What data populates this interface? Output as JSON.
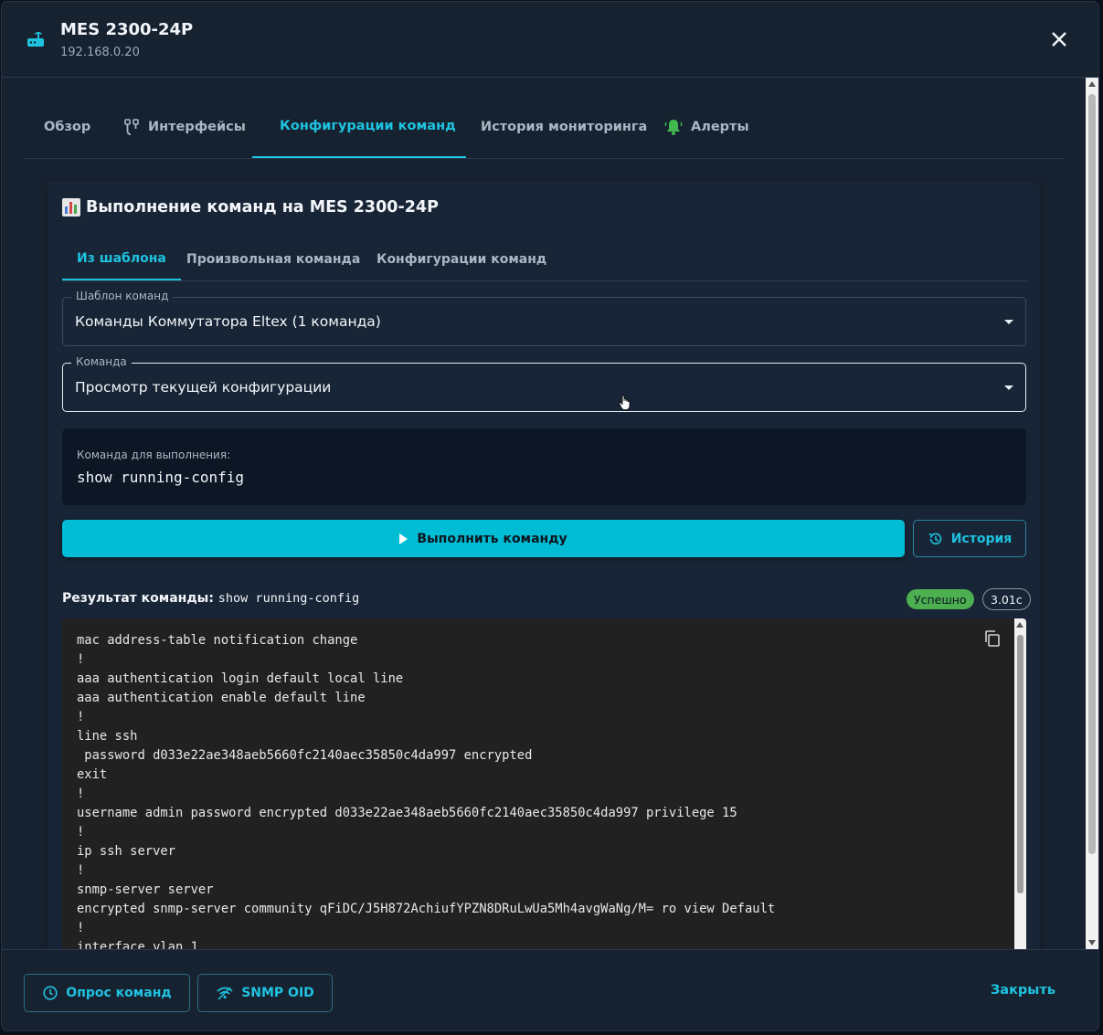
{
  "header": {
    "title": "MES 2300-24P",
    "subtitle": "192.168.0.20"
  },
  "tabs": [
    {
      "label": "Обзор",
      "icon": "none",
      "active": false
    },
    {
      "label": "Интерфейсы",
      "icon": "cable-icon",
      "active": false
    },
    {
      "label": "Конфигурации команд",
      "icon": "speedometer-icon",
      "active": true
    },
    {
      "label": "История мониторинга",
      "icon": "none",
      "active": false
    },
    {
      "label": "Алерты",
      "icon": "bell-icon",
      "active": false
    }
  ],
  "card": {
    "title": "Выполнение команд на MES 2300-24P",
    "title_icon": "bar-chart-emoji",
    "subtabs": [
      {
        "label": "Из шаблона",
        "active": true
      },
      {
        "label": "Произвольная команда",
        "active": false
      },
      {
        "label": "Конфигурации команд",
        "active": false
      }
    ],
    "template_field": {
      "label": "Шаблон команд",
      "value": "Команды Коммутатора Eltex (1 команда)"
    },
    "command_field": {
      "label": "Команда",
      "value": "Просмотр текущей конфигурации"
    },
    "command_box": {
      "label": "Команда для выполнения:",
      "command": "show running-config"
    },
    "run_button": "Выполнить команду",
    "history_button": "История",
    "result": {
      "label": "Результат команды:",
      "command": "show running-config",
      "status": "Успешно",
      "duration": "3.01с",
      "output_lines": [
        "mac address-table notification change",
        "!",
        "aaa authentication login default local line",
        "aaa authentication enable default line",
        "!",
        "line ssh",
        " password d033e22ae348aeb5660fc2140aec35850c4da997 encrypted",
        "exit",
        "!",
        "username admin password encrypted d033e22ae348aeb5660fc2140aec35850c4da997 privilege 15",
        "!",
        "ip ssh server",
        "!",
        "snmp-server server",
        "encrypted snmp-server community qFiDC/J5H872AchiufYPZN8DRuLwUa5Mh4avgWaNg/M= ro view Default",
        "!",
        "interface vlan 1"
      ]
    }
  },
  "footer": {
    "poll_button": "Опрос команд",
    "snmp_button": "SNMP OID",
    "close_link": "Закрыть"
  },
  "colors": {
    "accent": "#1ec3e0",
    "success": "#4caf50",
    "background": "#172231"
  }
}
